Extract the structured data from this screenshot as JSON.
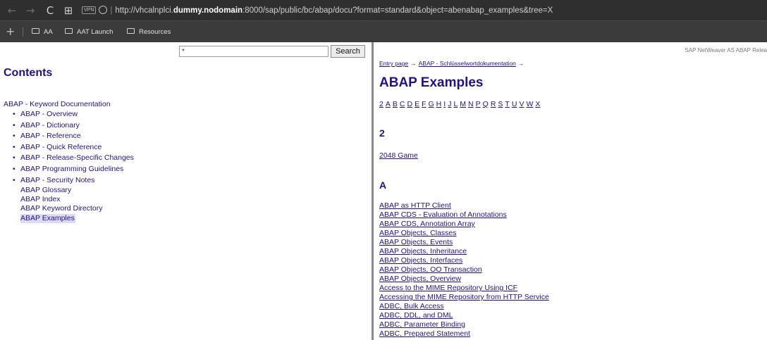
{
  "browser": {
    "nav": {
      "back": "←",
      "forward": "→",
      "reload": "C",
      "apps": "⊞"
    },
    "url_prefix": "http://vhcalnplci.",
    "url_host": "dummy.nodomain",
    "url_suffix": ":8000/sap/public/bc/abap/docu?format=standard&object=abenabap_examples&tree=X",
    "vpn_badge": "VPN",
    "separator": "|",
    "bookmarks": [
      {
        "label": "AA"
      },
      {
        "label": "AAT Launch"
      },
      {
        "label": "Resources"
      }
    ],
    "new_tab": "+"
  },
  "left": {
    "search": {
      "value": "*",
      "button": "Search"
    },
    "title": "Contents",
    "root": "ABAP - Keyword Documentation",
    "items": [
      "ABAP - Overview",
      "ABAP - Dictionary",
      "ABAP - Reference",
      "ABAP - Quick Reference",
      "ABAP - Release-Specific Changes",
      "ABAP Programming Guidelines",
      "ABAP - Security Notes"
    ],
    "plain_items": [
      "ABAP Glossary",
      "ABAP Index",
      "ABAP Keyword Directory",
      "ABAP Examples"
    ]
  },
  "right": {
    "header_note": "SAP NetWeaver AS ABAP Relea",
    "breadcrumb": [
      "Entry page",
      "ABAP - Schlüsselwortdokumentation"
    ],
    "breadcrumb_arrow": "→",
    "title": "ABAP Examples",
    "alphabet": [
      "2",
      "A",
      "B",
      "C",
      "D",
      "E",
      "F",
      "G",
      "H",
      "I",
      "J",
      "L",
      "M",
      "N",
      "P",
      "Q",
      "R",
      "S",
      "T",
      "U",
      "V",
      "W",
      "X"
    ],
    "section_2": {
      "heading": "2",
      "links": [
        "2048 Game"
      ]
    },
    "section_a": {
      "heading": "A",
      "links": [
        "ABAP as HTTP Client",
        "ABAP CDS - Evaluation of Annotations",
        "ABAP CDS, Annotation Array",
        "ABAP Objects, Classes",
        "ABAP Objects, Events",
        "ABAP Objects, Inheritance",
        "ABAP Objects, Interfaces",
        "ABAP Objects, OO Transaction",
        "ABAP Objects, Overview",
        "Access to the MIME Repository Using ICF",
        "Accessing the MIME Repository from HTTP Service",
        "ADBC, Bulk Access",
        "ADBC, DDL, and DML",
        "ADBC, Parameter Binding",
        "ADBC, Prepared Statement"
      ]
    }
  }
}
